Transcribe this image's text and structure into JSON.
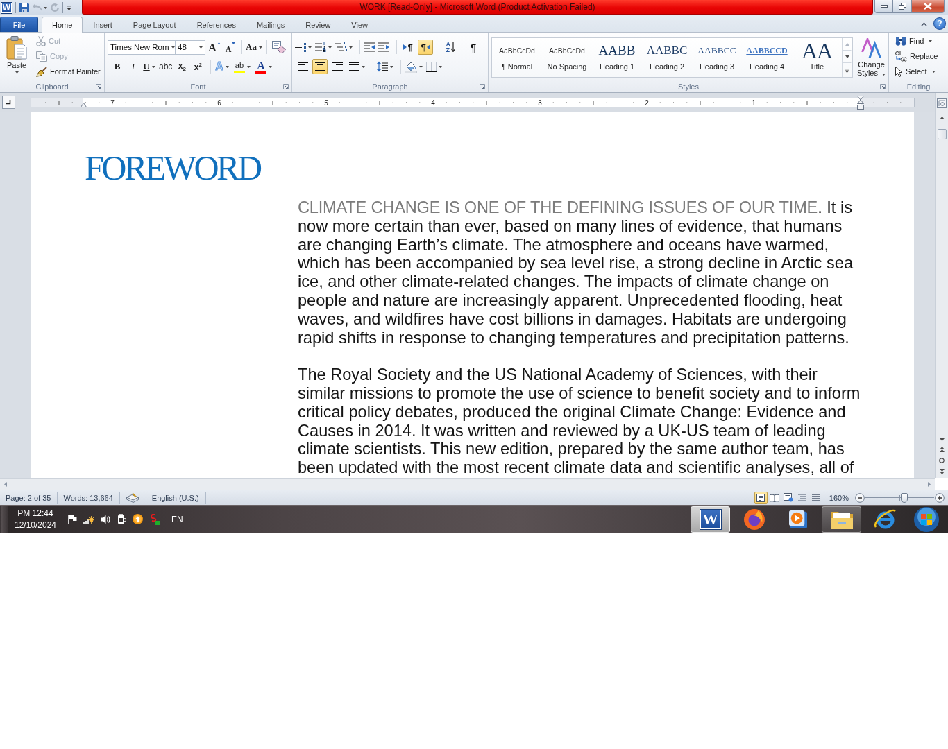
{
  "title_bar": {
    "app_icon": "W",
    "title": "WORK [Read-Only] - Microsoft Word (Product Activation Failed)"
  },
  "ribbon_tabs": [
    {
      "label": "File",
      "kind": "file",
      "selected": false
    },
    {
      "label": "Home",
      "kind": "tab",
      "selected": true
    },
    {
      "label": "Insert",
      "kind": "tab",
      "selected": false
    },
    {
      "label": "Page Layout",
      "kind": "tab",
      "selected": false
    },
    {
      "label": "References",
      "kind": "tab",
      "selected": false
    },
    {
      "label": "Mailings",
      "kind": "tab",
      "selected": false
    },
    {
      "label": "Review",
      "kind": "tab",
      "selected": false
    },
    {
      "label": "View",
      "kind": "tab",
      "selected": false
    }
  ],
  "help_button": {
    "label": "?"
  },
  "clipboard": {
    "label": "Clipboard",
    "paste": "Paste",
    "commands": [
      {
        "label": "Cut",
        "kind": "cut",
        "disabled": true
      },
      {
        "label": "Copy",
        "kind": "copy",
        "disabled": true
      },
      {
        "label": "Format Painter",
        "kind": "format-painter",
        "disabled": false
      }
    ]
  },
  "font": {
    "label": "Font",
    "font_name": "Times New Rom",
    "font_size": "48",
    "size_buttons": [
      {
        "label": "A",
        "kind": "grow"
      },
      {
        "label": "A",
        "kind": "shrink"
      }
    ],
    "case_button": "Aa",
    "format_buttons": [
      {
        "label": "B",
        "kind": "bold"
      },
      {
        "label": "I",
        "kind": "italic"
      },
      {
        "label": "U",
        "kind": "underline"
      },
      {
        "label": "abc",
        "kind": "strikethrough"
      },
      {
        "label": "x$_{2}$",
        "kind": "subscript"
      },
      {
        "label": "x$^{2}$",
        "kind": "superscript"
      }
    ],
    "color_buttons": [
      {
        "label": "A",
        "kind": "text-effects"
      },
      {
        "label": "ab",
        "kind": "highlight",
        "color": "#ffff00"
      },
      {
        "label": "A",
        "kind": "font-color",
        "color": "#ff0000"
      }
    ]
  },
  "paragraph": {
    "label": "Paragraph",
    "direction": [
      {
        "label": "¶",
        "kind": "ltr",
        "selected": false
      },
      {
        "label": "¶",
        "kind": "rtl",
        "selected": true
      }
    ],
    "sort": "AZ",
    "show_marks": "¶",
    "alignment": [
      {
        "kind": "left",
        "selected": false
      },
      {
        "kind": "center",
        "selected": true
      },
      {
        "kind": "right",
        "selected": false
      },
      {
        "kind": "justify",
        "selected": false
      }
    ]
  },
  "styles": {
    "label": "Styles",
    "gallery": [
      {
        "preview": "AaBbCcDd",
        "name": "¶ Normal",
        "kind": "normal"
      },
      {
        "preview": "AaBbCcDd",
        "name": "No Spacing",
        "kind": "no-spacing"
      },
      {
        "preview": "AABB",
        "name": "Heading 1",
        "kind": "heading-1"
      },
      {
        "preview": "AABBC",
        "name": "Heading 2",
        "kind": "heading-2"
      },
      {
        "preview": "AABBCC",
        "name": "Heading 3",
        "kind": "heading-3"
      },
      {
        "preview": "AABBCCD",
        "name": "Heading 4",
        "kind": "heading-4"
      },
      {
        "preview": "AA",
        "name": "Title",
        "kind": "title"
      }
    ],
    "change_styles": "Change Styles"
  },
  "editing": {
    "label": "Editing",
    "commands": [
      {
        "label": "Find",
        "kind": "find"
      },
      {
        "label": "Replace",
        "kind": "replace"
      },
      {
        "label": "Select",
        "kind": "select"
      }
    ]
  },
  "ruler": {
    "numbers": [
      "7",
      "6",
      "5",
      "4",
      "3",
      "2",
      "1"
    ]
  },
  "document": {
    "heading": "FOREWORD",
    "paragraphs": [
      {
        "lead": "CLIMATE CHANGE IS ONE OF THE DEFINING ISSUES OF OUR TIME",
        "text": ". It is now more certain than ever, based on many lines of evidence, that humans are changing Earth’s climate. The atmosphere and oceans have warmed, which has been accompanied by sea level rise, a strong decline in Arctic sea ice, and other climate-related changes. The impacts of climate change on people and nature are increasingly apparent. Unprecedented flooding, heat waves, and wildfires have cost billions in damages. Habitats are undergoing rapid shifts in response to changing temperatures and precipitation patterns."
      },
      {
        "text": "The Royal Society and the US National Academy of Sciences, with their similar missions to promote the use of science to benefit society and to inform critical policy debates, produced the original Climate Change: Evidence and Causes in 2014. It was written and reviewed by a UK-US team of leading climate scientists. This new edition, prepared by the same author team, has been updated with the most recent climate data and scientific analyses, all of"
      }
    ]
  },
  "status_bar": {
    "page": "Page: 2 of 35",
    "words": "Words: 13,664",
    "language": "English (U.S.)",
    "views": [
      {
        "kind": "print-layout",
        "selected": true
      },
      {
        "kind": "reading",
        "selected": false
      },
      {
        "kind": "web",
        "selected": false
      },
      {
        "kind": "outline",
        "selected": false
      },
      {
        "kind": "draft",
        "selected": false
      }
    ],
    "zoom": "160%",
    "zoom_slider": {
      "level": 0.57
    }
  },
  "taskbar": {
    "time": "PM 12:44",
    "date": "12/10/2024",
    "language": "EN",
    "apps": [
      {
        "kind": "word",
        "label": "W",
        "open": true,
        "selected": true
      },
      {
        "kind": "firefox",
        "open": false,
        "selected": false
      },
      {
        "kind": "media",
        "open": false,
        "selected": false
      },
      {
        "kind": "explorer",
        "open": true,
        "selected": false
      },
      {
        "kind": "browser",
        "open": false,
        "selected": false
      }
    ]
  }
}
